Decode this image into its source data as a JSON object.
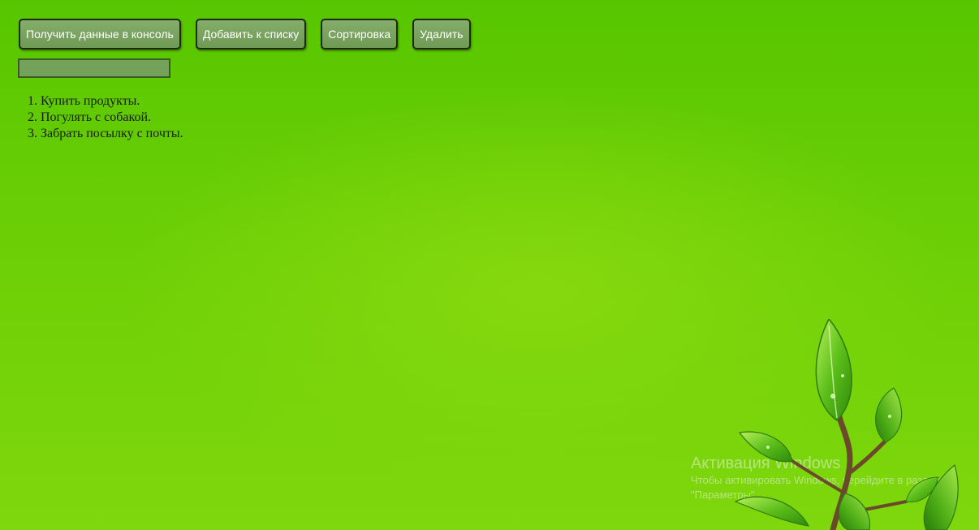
{
  "toolbar": {
    "console_label": "Получить данные в консоль",
    "add_label": "Добавить к списку",
    "sort_label": "Сортировка",
    "delete_label": "Удалить"
  },
  "input": {
    "value": ""
  },
  "todo_items": [
    "Купить продукты.",
    "Погулять с собакой.",
    "Забрать посылку с почты."
  ],
  "watermark": {
    "title": "Активация Windows",
    "subtitle": "Чтобы активировать Windows, перейдите в раздел \"Параметры\"."
  },
  "decoration": {
    "icon": "green-leaves-illustration",
    "accent": "#6ccf06"
  }
}
